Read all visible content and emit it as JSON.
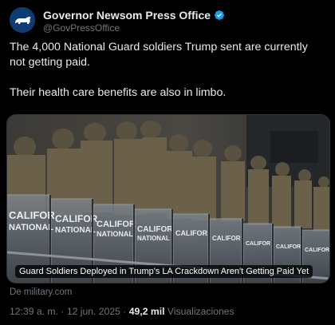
{
  "author": {
    "display_name": "Governor Newsom Press Office",
    "handle": "@GovPressOffice",
    "verified": true,
    "avatar_icon": "bear-flag-avatar",
    "verified_icon": "verified-badge-icon",
    "verified_color": "#1d9bf0"
  },
  "tweet": {
    "paragraphs": [
      "The 4,000 National Guard soldiers Trump sent are currently not getting paid.",
      "Their health care benefits are also in limbo."
    ]
  },
  "media": {
    "image_kind": "photo",
    "caption": "Guard Soldiers Deployed in Trump's LA Crackdown Aren't Getting Paid Yet",
    "shield_text_1": "CALIFOR",
    "shield_text_2": "NATIONAL"
  },
  "link_source": "De military.com",
  "meta": {
    "time": "12:39 a. m.",
    "separator": "·",
    "date": "12 jun. 2025",
    "views_count": "49,2 mil",
    "views_label": "Visualizaciones"
  },
  "colors": {
    "background": "#000000",
    "text_primary": "#e7e9ea",
    "text_secondary": "#71767b",
    "accent": "#1d9bf0"
  }
}
